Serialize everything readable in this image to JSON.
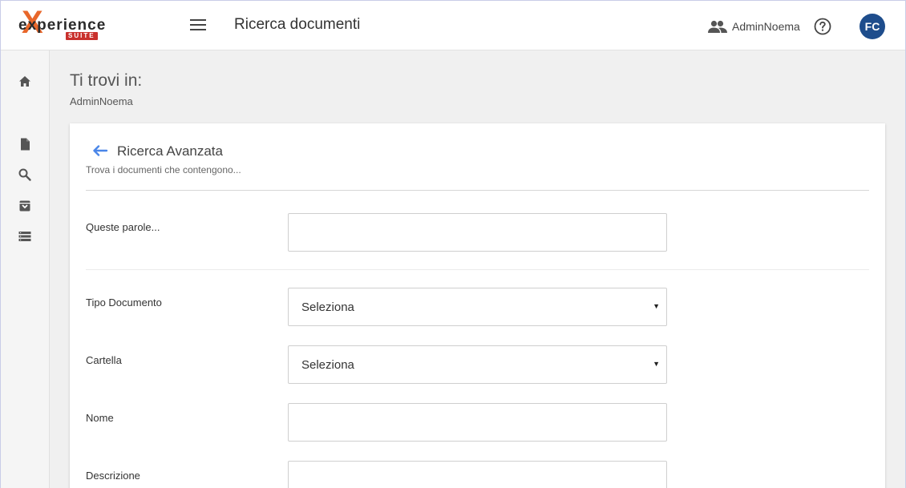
{
  "app": {
    "logo_main": "experience",
    "logo_sub": "SUITE",
    "page_title": "Ricerca documenti",
    "user_name": "AdminNoema",
    "avatar_initials": "FC"
  },
  "sidebar": {
    "items": [
      {
        "icon": "home-icon"
      },
      {
        "icon": "document-icon"
      },
      {
        "icon": "search-icon"
      },
      {
        "icon": "archive-icon"
      },
      {
        "icon": "list-icon"
      }
    ]
  },
  "breadcrumb": {
    "title": "Ti trovi in:",
    "path": "AdminNoema"
  },
  "search": {
    "title": "Ricerca Avanzata",
    "subtitle": "Trova i documenti che contengono...",
    "fields": {
      "words_label": "Queste parole...",
      "words_value": "",
      "doc_type_label": "Tipo Documento",
      "doc_type_value": "Seleziona",
      "folder_label": "Cartella",
      "folder_value": "Seleziona",
      "name_label": "Nome",
      "name_value": "",
      "description_label": "Descrizione",
      "description_value": ""
    }
  },
  "colors": {
    "accent_blue": "#4a86e8",
    "avatar_bg": "#1e4d8c",
    "logo_orange": "#e8672a",
    "logo_red": "#c9302c"
  }
}
